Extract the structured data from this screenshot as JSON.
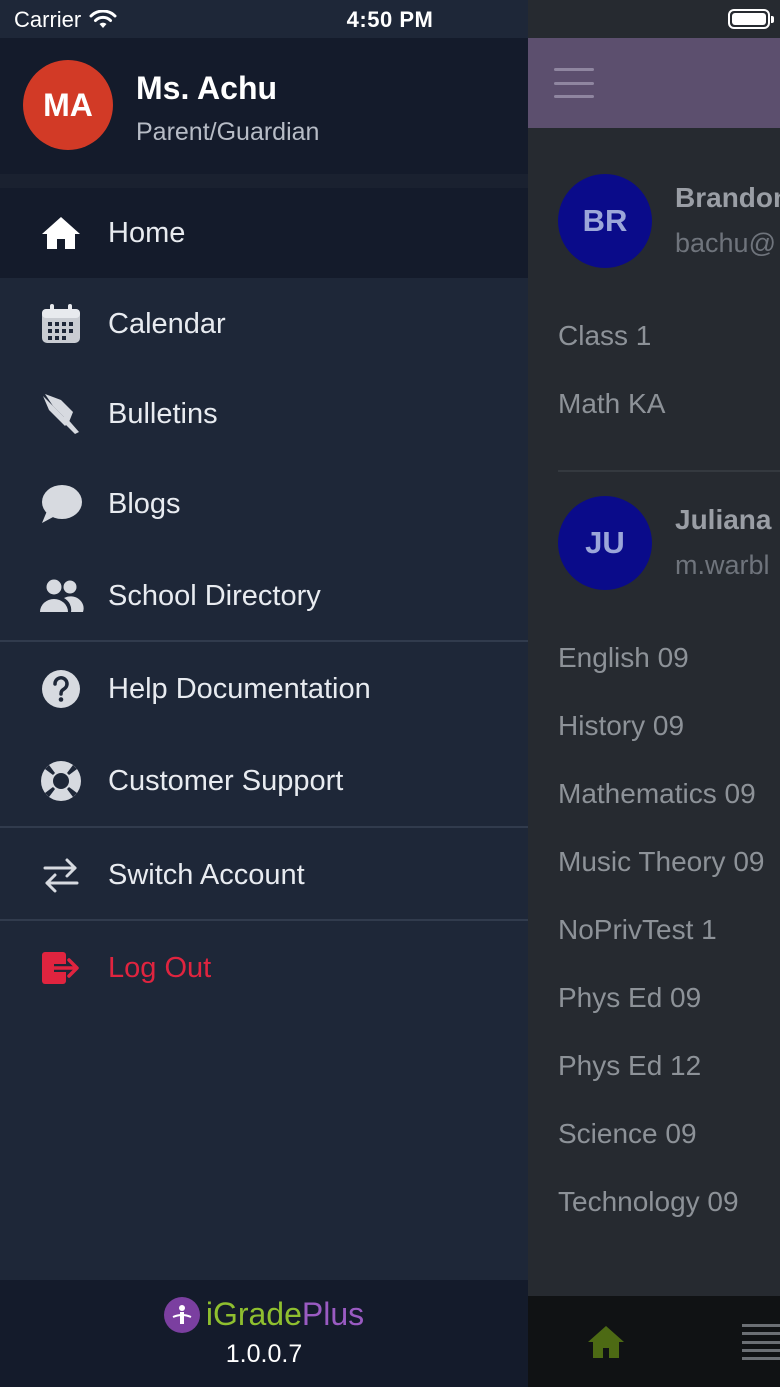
{
  "status_bar": {
    "carrier": "Carrier",
    "time": "4:50 PM"
  },
  "drawer": {
    "user": {
      "initials": "MA",
      "name": "Ms. Achu",
      "role": "Parent/Guardian"
    },
    "items": [
      {
        "label": "Home",
        "icon": "home-icon"
      },
      {
        "label": "Calendar",
        "icon": "calendar-icon"
      },
      {
        "label": "Bulletins",
        "icon": "pin-icon"
      },
      {
        "label": "Blogs",
        "icon": "chat-bubble-icon"
      },
      {
        "label": "School Directory",
        "icon": "users-icon"
      },
      {
        "label": "Help Documentation",
        "icon": "help-icon"
      },
      {
        "label": "Customer Support",
        "icon": "lifebuoy-icon"
      },
      {
        "label": "Switch Account",
        "icon": "switch-icon"
      },
      {
        "label": "Log Out",
        "icon": "logout-icon"
      }
    ],
    "footer": {
      "brand_i": "i",
      "brand_grade": "Grade",
      "brand_plus": "Plus",
      "version": "1.0.0.7"
    },
    "colors": {
      "avatar": "#d23a26",
      "logout": "#e0243f",
      "brand_green": "#8fbf2f",
      "brand_purple": "#9a5bc2"
    }
  },
  "background": {
    "students": [
      {
        "initials": "BR",
        "name": "Brandon",
        "email": "bachu@",
        "classes": [
          "Class 1",
          "Math KA"
        ]
      },
      {
        "initials": "JU",
        "name": "Juliana",
        "email": "m.warbl",
        "classes": [
          "English 09",
          "History 09",
          "Mathematics 09",
          "Music Theory 09",
          "NoPrivTest 1",
          "Phys Ed 09",
          "Phys Ed 12",
          "Science 09",
          "Technology 09"
        ]
      }
    ]
  }
}
